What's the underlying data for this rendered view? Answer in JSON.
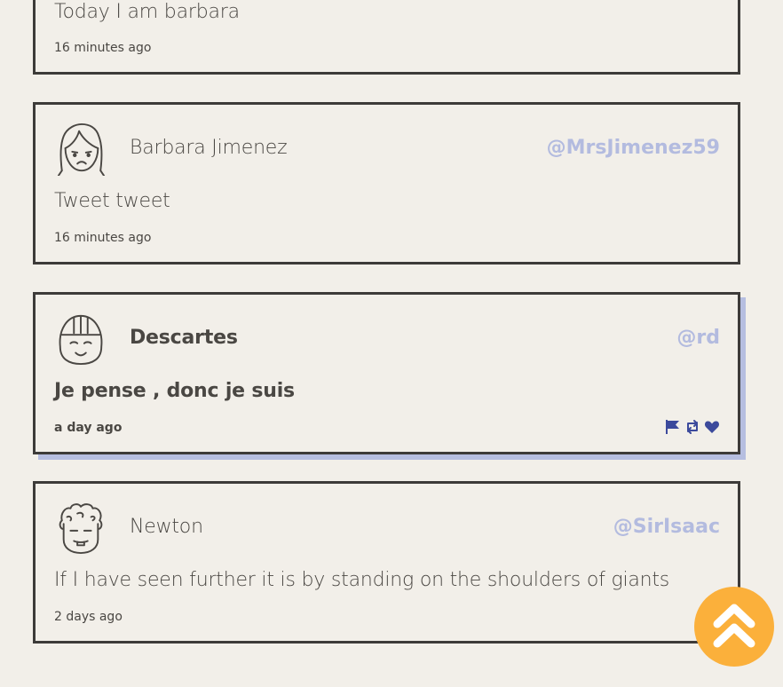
{
  "tweets": [
    {
      "author": "",
      "handle": "",
      "text": "Today I am barbara",
      "time": "16 minutes ago"
    },
    {
      "author": "Barbara Jimenez",
      "handle": "@MrsJimenez59",
      "avatar": "woman-frown-avatar",
      "text": "Tweet tweet",
      "time": "16 minutes ago"
    },
    {
      "author": "Descartes",
      "handle": "@rd",
      "avatar": "girl-smile-avatar",
      "text": "Je pense , donc je suis",
      "time": "a day ago",
      "actions": [
        "flag-icon",
        "retweet-icon",
        "heart-icon"
      ]
    },
    {
      "author": "Newton",
      "handle": "@SirIsaac",
      "avatar": "curly-hair-avatar",
      "text": "If I have seen further it is by standing on the shoulders of giants",
      "time": "2 days ago"
    }
  ],
  "colors": {
    "background": "#f2efe9",
    "border": "#3d3b39",
    "handle": "#b3bbdf",
    "highlight_shadow": "#b6bee0",
    "action_icons": "#3c4a9c",
    "scroll_button": "#fbb03b"
  },
  "scroll_top_icon": "double-chevron-up-icon"
}
